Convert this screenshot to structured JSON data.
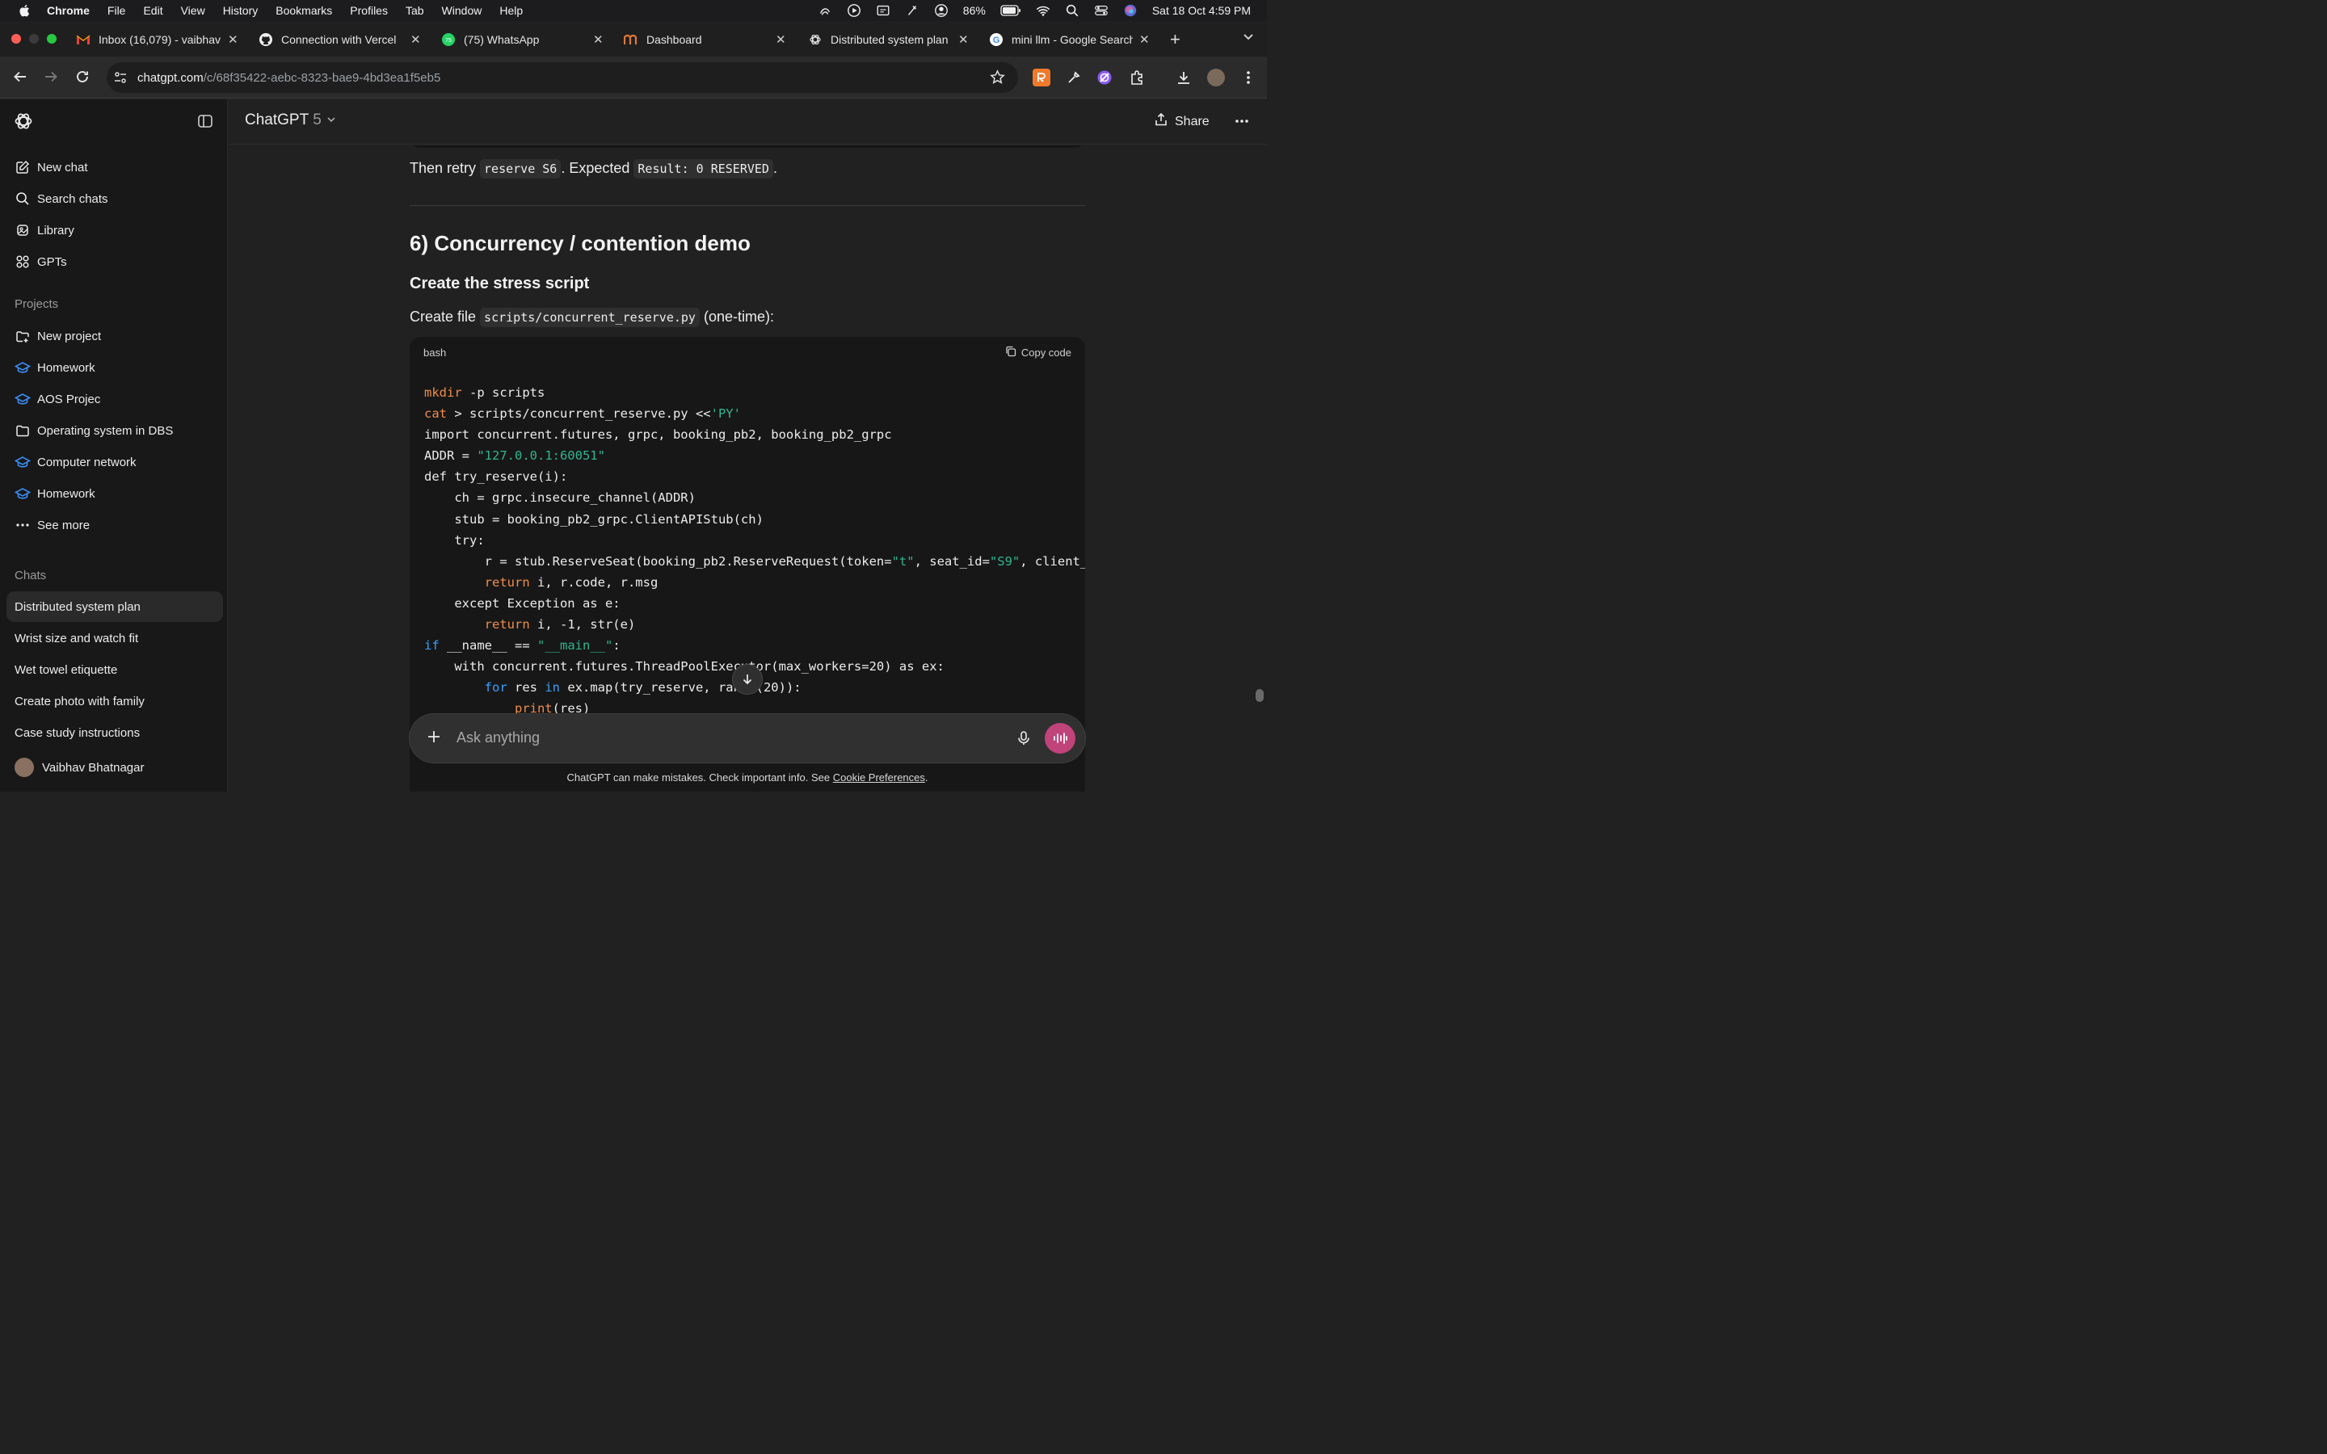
{
  "menubar": {
    "app_name": "Chrome",
    "items": [
      "File",
      "Edit",
      "View",
      "History",
      "Bookmarks",
      "Profiles",
      "Tab",
      "Window",
      "Help"
    ],
    "battery": "86%",
    "datetime": "Sat 18 Oct  4:59 PM"
  },
  "tabs": [
    {
      "title": "Inbox (16,079) - vaibhav",
      "icon": "gmail-icon"
    },
    {
      "title": "Connection with Vercel",
      "icon": "github-icon"
    },
    {
      "title": "(75) WhatsApp",
      "icon": "whatsapp-icon",
      "badge": "75"
    },
    {
      "title": "Dashboard",
      "icon": "dashboard-icon"
    },
    {
      "title": "Distributed system plan",
      "icon": "chatgpt-icon"
    },
    {
      "title": "mini llm - Google Search",
      "icon": "google-icon"
    }
  ],
  "address": {
    "host": "chatgpt.com",
    "path": "/c/68f35422-aebc-8323-bae9-4bd3ea1f5eb5"
  },
  "sidebar": {
    "top_items": [
      {
        "label": "New chat",
        "icon": "new-chat-icon"
      },
      {
        "label": "Search chats",
        "icon": "search-icon"
      },
      {
        "label": "Library",
        "icon": "library-icon"
      },
      {
        "label": "GPTs",
        "icon": "gpts-icon"
      }
    ],
    "projects_title": "Projects",
    "projects": [
      {
        "label": "New project",
        "icon": "new-folder-icon"
      },
      {
        "label": "Homework",
        "icon": "graduation-cap-icon"
      },
      {
        "label": "AOS Projec",
        "icon": "graduation-cap-icon"
      },
      {
        "label": "Operating system in DBS",
        "icon": "folder-icon"
      },
      {
        "label": "Computer network",
        "icon": "graduation-cap-icon"
      },
      {
        "label": "Homework",
        "icon": "graduation-cap-icon"
      },
      {
        "label": "See more",
        "icon": "ellipsis-icon"
      }
    ],
    "chats_title": "Chats",
    "chats": [
      "Distributed system plan",
      "Wrist size and watch fit",
      "Wet towel etiquette",
      "Create photo with family",
      "Case study instructions"
    ],
    "user_name": "Vaibhav Bhatnagar"
  },
  "header": {
    "model": "ChatGPT",
    "version": "5",
    "share_label": "Share"
  },
  "content": {
    "retry_prefix": "Then retry ",
    "retry_code": "reserve S6",
    "retry_mid": ". Expected ",
    "retry_result": "Result: 0 RESERVED",
    "retry_suffix": ".",
    "heading": "6) Concurrency / contention demo",
    "subheading": "Create the stress script",
    "create_prefix": "Create file ",
    "create_file": "scripts/concurrent_reserve.py",
    "create_suffix": " (one-time):",
    "code_lang": "bash",
    "copy_label": "Copy code"
  },
  "composer": {
    "placeholder": "Ask anything",
    "disclaimer_text": "ChatGPT can make mistakes. Check important info. See ",
    "disclaimer_link": "Cookie Preferences",
    "disclaimer_end": "."
  }
}
